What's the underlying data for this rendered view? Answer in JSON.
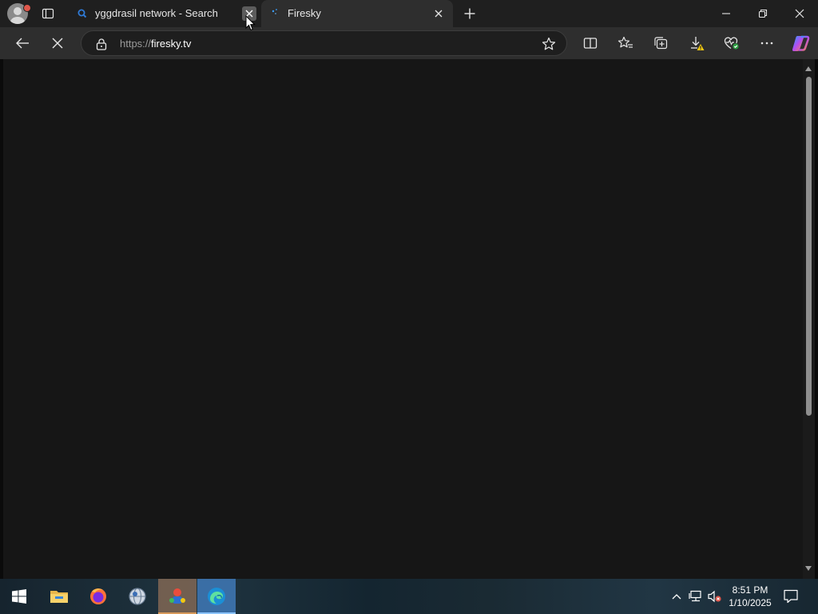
{
  "browser": {
    "tabs": [
      {
        "title": "yggdrasil network - Search",
        "icon": "search-icon",
        "state": "inactive"
      },
      {
        "title": "Firesky",
        "icon": "firesky-favicon",
        "state": "active"
      }
    ],
    "address_bar": {
      "scheme": "https://",
      "host": "firesky.tv",
      "loading": true
    },
    "toolbar_icons": [
      "split-screen-icon",
      "favorites-icon",
      "collections-icon",
      "downloads-icon",
      "browser-essentials-icon",
      "more-icon",
      "copilot-icon"
    ]
  },
  "page": {
    "background": "#161616",
    "scroll_fraction_visible": 0.67
  },
  "taskbar": {
    "pinned": [
      "start-button",
      "file-explorer",
      "firefox",
      "app-globe",
      "app-mascot",
      "edge"
    ],
    "clock": {
      "time": "8:51 PM",
      "date": "1/10/2025"
    }
  },
  "colors": {
    "tabstrip": "#1f1f1f",
    "toolbar": "#2e2e2e",
    "accent": "#0078d4"
  }
}
